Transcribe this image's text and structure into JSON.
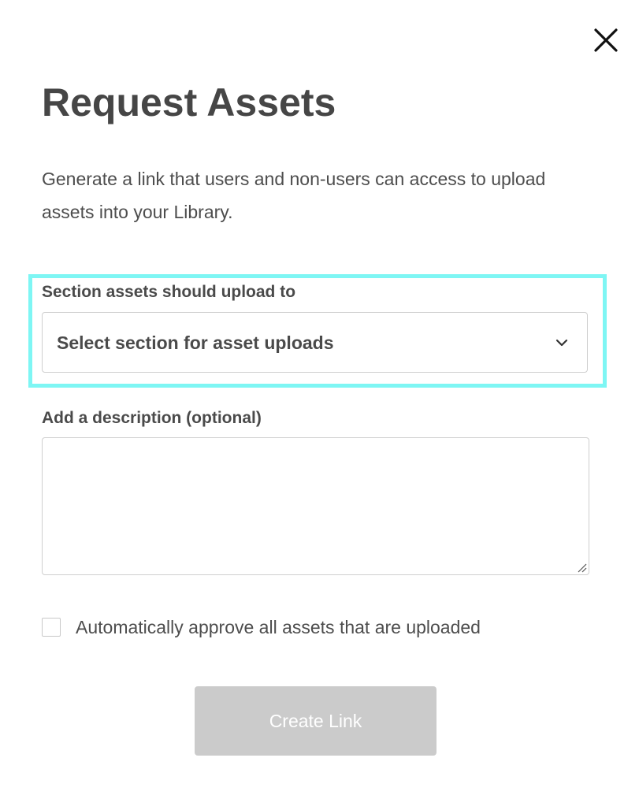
{
  "modal": {
    "title": "Request Assets",
    "intro": "Generate a link that users and non-users can access to upload assets into your Library.",
    "close_icon": "close-icon"
  },
  "section_field": {
    "label": "Section assets should upload to",
    "selected_value": "Select section for asset uploads",
    "dropdown_icon": "chevron-down-icon"
  },
  "description_field": {
    "label": "Add a description (optional)",
    "value": ""
  },
  "auto_approve": {
    "label": "Automatically approve all assets that are uploaded",
    "checked": false
  },
  "actions": {
    "create_label": "Create Link",
    "create_disabled": true
  },
  "colors": {
    "highlight": "#7ef6f4",
    "button_disabled": "#cbcbcb",
    "text": "#4a4a4a"
  }
}
